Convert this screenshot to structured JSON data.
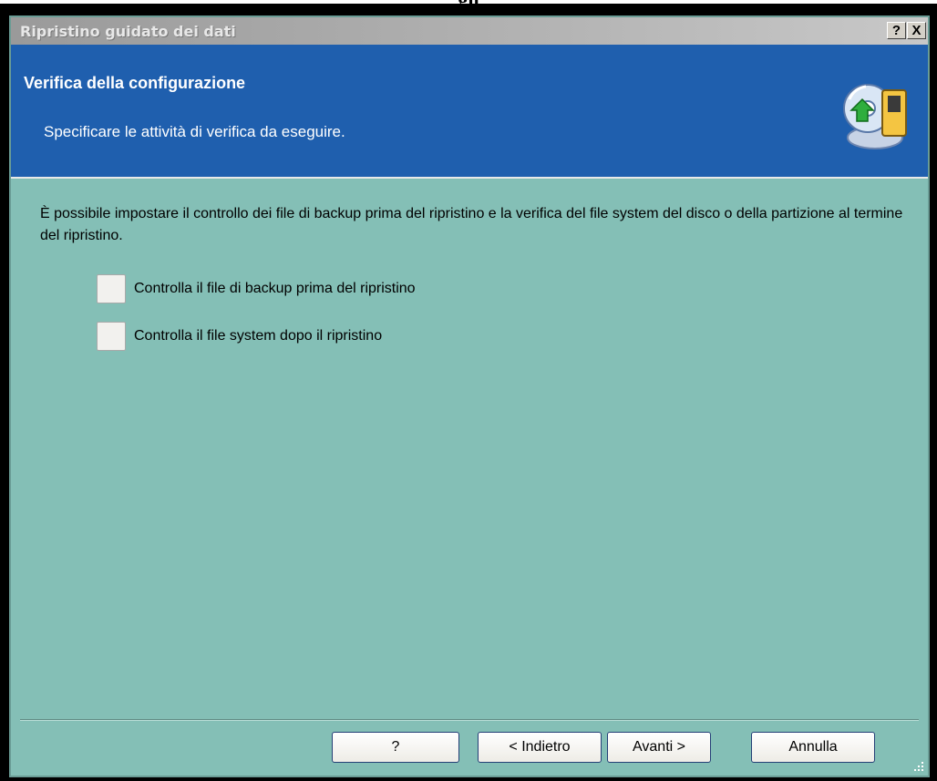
{
  "top_text": "gn",
  "window": {
    "title": "Ripristino guidato dei dati",
    "help_button": "?",
    "close_button": "X"
  },
  "header": {
    "title": "Verifica della configurazione",
    "subtitle": "Specificare le attività di verifica da eseguire.",
    "icon": "restore-disk-icon"
  },
  "body": {
    "description": "È possibile impostare il controllo dei file di backup prima del ripristino e la verifica del file system del disco o della partizione al termine del ripristino.",
    "checkboxes": [
      {
        "label": "Controlla il file di backup prima del ripristino",
        "checked": false
      },
      {
        "label": "Controlla il file system dopo il ripristino",
        "checked": false
      }
    ]
  },
  "footer": {
    "help_label": "?",
    "back_label": "< Indietro",
    "next_label": "Avanti >",
    "cancel_label": "Annulla"
  },
  "colors": {
    "header_bg": "#1f5fae",
    "body_bg": "#84bfb6",
    "button_border": "#243f76"
  }
}
